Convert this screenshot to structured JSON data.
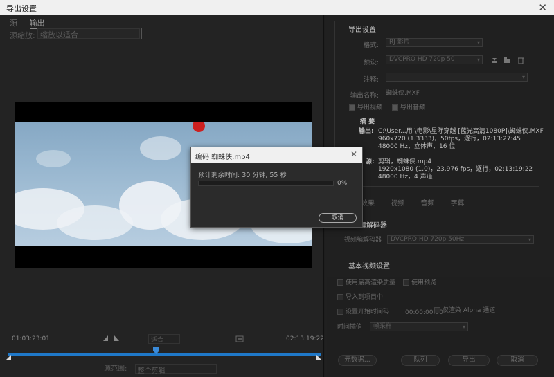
{
  "window": {
    "title": "导出设置",
    "close_glyph": "✕"
  },
  "left": {
    "tabs": [
      "源",
      "输出"
    ],
    "source_label": "源缩放:",
    "source_value": "缩放以适合",
    "time_in": "01:03:23:01",
    "time_out": "02:13:19:22",
    "fit_value": "适合",
    "source_range_label": "源范围:",
    "source_range_value": "整个剪辑",
    "timeline_accent": "#1f78c8"
  },
  "right": {
    "section_export": "导出设置",
    "format_label": "格式:",
    "format_value": "RJ 影片",
    "preset_label": "预设:",
    "preset_value": "DVCPRO HD 720p 50",
    "comment_label": "注释:",
    "output_name_label": "输出名称:",
    "output_name_value": "蜘蛛侠.MXF",
    "export_video": "导出视频",
    "export_audio": "导出音频",
    "summary_title": "摘 要",
    "output_label": "输出:",
    "output_lines": [
      "C:\\User...用 \\电影\\星际穿越 [蓝光高清1080P]\\蜘蛛侠.MXF",
      "960x720 (1.3333)，50fps，逐行，02:13:27:45",
      "48000 Hz，立体声，16 位"
    ],
    "source_label": "源:",
    "source_lines": [
      "剪辑，蜘蛛侠.mp4",
      "1920x1080 (1.0)，23.976 fps，逐行，02:13:19:22",
      "48000 Hz，4 声道"
    ],
    "subtabs": [
      "效果",
      "视频",
      "音频",
      "字幕"
    ],
    "codec_title": "视频编解码器",
    "codec_label": "视频编解码器",
    "codec_value": "DVCPRO HD 720p 50Hz",
    "basic_title": "基本视频设置",
    "max_render": "使用最高渲染质量",
    "use_preview": "使用预览",
    "import_project": "导入到项目中",
    "set_start_tc": "设置开始时间码",
    "start_tc_value": "00:00:00:00",
    "alpha_only": "仅渲染 Alpha 通道",
    "interp_label": "时间插值",
    "interp_value": "帧采样",
    "btn_metadata": "元数据...",
    "btn_queue": "队列",
    "btn_export": "导出",
    "btn_cancel": "取消"
  },
  "modal": {
    "title": "编码 蜘蛛侠.mp4",
    "close_glyph": "✕",
    "eta": "预计剩余时间: 30 分钟, 55 秒",
    "progress_text": "0%",
    "progress_fraction": 0.0,
    "cancel": "取消",
    "accent": "#2d8ceb"
  }
}
